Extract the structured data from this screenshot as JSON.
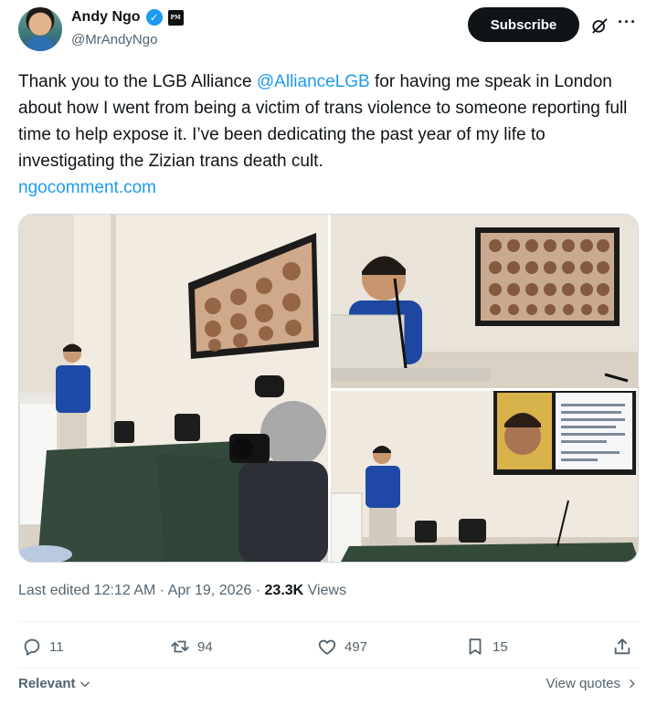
{
  "author": {
    "display_name": "Andy Ngo",
    "handle": "@MrAndyNgo",
    "affiliate_badge": "PM",
    "verified_icon": "verified-check-icon"
  },
  "header_actions": {
    "subscribe_label": "Subscribe",
    "grok_icon": "grok-icon",
    "more_icon": "more-icon"
  },
  "tweet": {
    "text_before": "Thank you to the LGB Alliance ",
    "mention": "@AllianceLGB",
    "text_after": " for having me speak in London about how I went from being a victim of trans violence to someone reporting full time to help expose it. I’ve been dedicating the past year of my life to investigating the Zizian trans death cult.",
    "link": "ngocomment.com"
  },
  "meta": {
    "edited": "Last edited 12:12 AM · Apr 19, 2026 · ",
    "views_count": "23.3K",
    "views_label": "Views"
  },
  "actions": {
    "replies": "11",
    "reposts": "94",
    "likes": "497",
    "bookmarks": "15"
  },
  "footer": {
    "sort_label": "Relevant",
    "view_quotes": "View quotes"
  },
  "colors": {
    "accent": "#1d9bf0",
    "text_primary": "#0f1419",
    "text_secondary": "#536471",
    "border": "#cfd9de"
  }
}
